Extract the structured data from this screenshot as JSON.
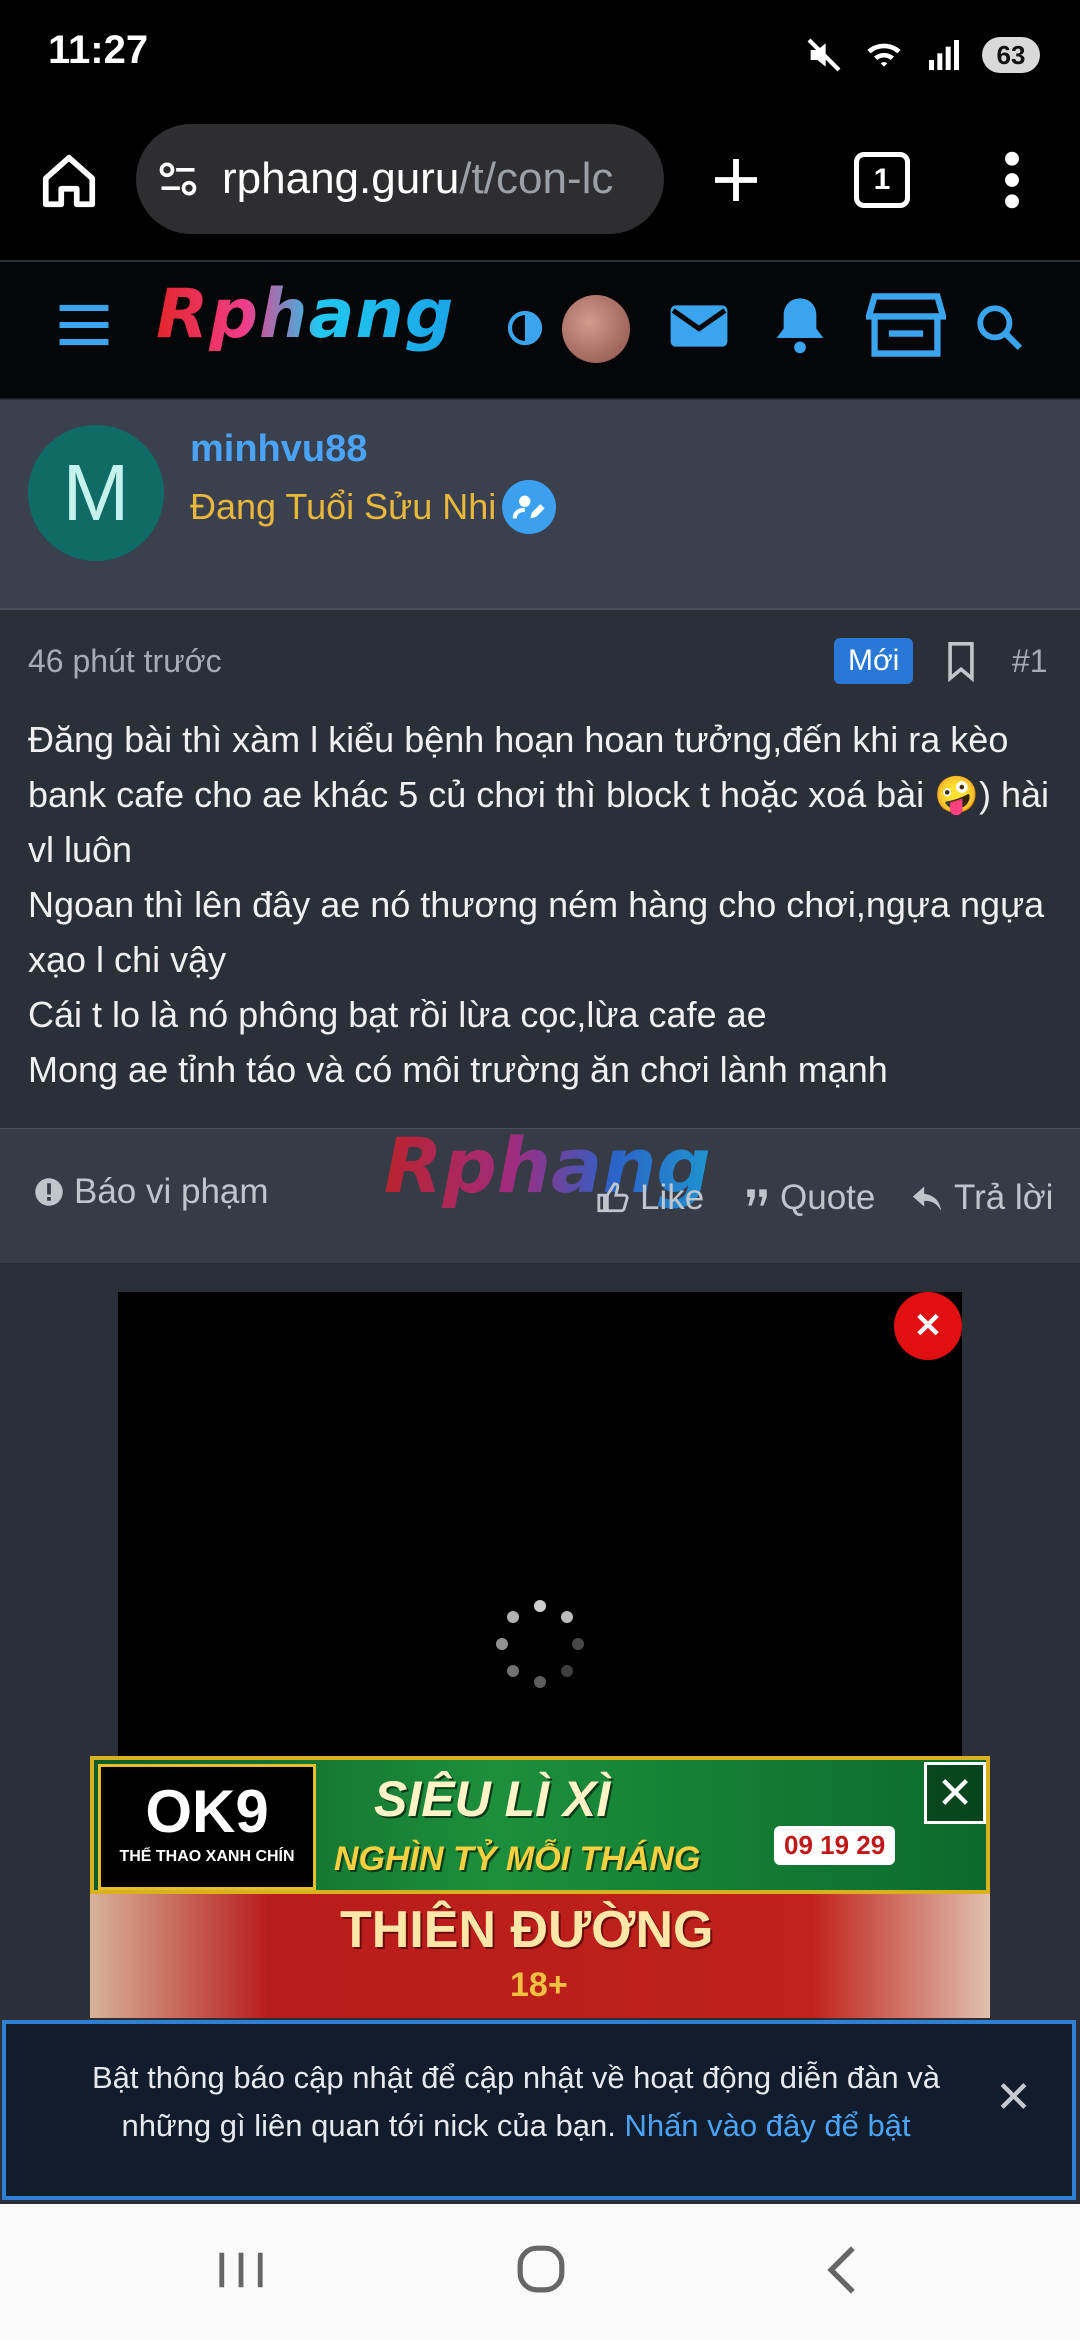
{
  "status_bar": {
    "time": "11:27",
    "battery": "63"
  },
  "browser": {
    "url_host": "rphang.guru",
    "url_path": "/t/con-lc",
    "tab_count": "1"
  },
  "site": {
    "logo_text": "Rphang"
  },
  "post": {
    "author": "minhvu88",
    "author_title": "Đang Tuổi Sửu Nhi",
    "avatar_letter": "M",
    "time_ago": "46 phút trước",
    "badge": "Mới",
    "number": "#1",
    "body": [
      "Đăng bài thì xàm l kiểu bệnh hoạn hoan tưởng,đến khi ra kèo bank cafe cho ae khác 5 củ chơi thì block t hoặc xoá bài 🤪) hài vl luôn",
      "Ngoan thì lên đây ae nó thương ném hàng cho chơi,ngựa ngựa xạo l chi vậy",
      "Cái t lo là nó phông bạt rồi lừa cọc,lừa cafe ae",
      "Mong ae tỉnh táo và có môi trường ăn chơi lành mạnh"
    ],
    "actions": {
      "report": "Báo vi phạm",
      "like": "Like",
      "quote": "Quote",
      "reply": "Trả lời"
    },
    "watermark": "Rphang"
  },
  "ad": {
    "logo": "OK9",
    "logo_sub": "THỂ THAO XANH CHÍN",
    "line1": "SIÊU LÌ XÌ",
    "line2": "NGHÌN TỶ MỖI THÁNG",
    "countdown": "09 19 29",
    "line3": "THIÊN ĐƯỜNG",
    "line3_sub": "18+"
  },
  "notice": {
    "text": "Bật thông báo cập nhật để cập nhật về hoạt động diễn đàn và những gì liên quan tới nick của bạn.",
    "link": "Nhấn vào đây để bật"
  },
  "colors": {
    "accent_blue": "#4aa3f5",
    "title_gold": "#e9b83a",
    "badge_blue": "#2a78d6",
    "logo_red": "#e3262a",
    "logo_cyan": "#20c8f0"
  }
}
